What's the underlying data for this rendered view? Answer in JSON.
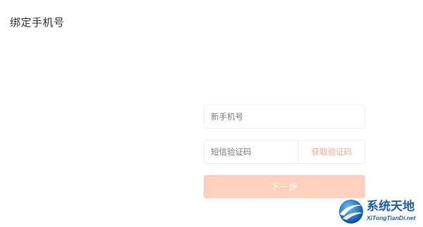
{
  "page": {
    "title": "绑定手机号"
  },
  "form": {
    "phone_placeholder": "新手机号",
    "code_placeholder": "短信验证码",
    "get_code_label": "获取验证码",
    "next_label": "下一步"
  },
  "watermark": {
    "cn_text": "系统天地",
    "en_text": "XiTongTianDi.net",
    "logo_icon": "globe-swoosh-icon"
  },
  "colors": {
    "accent_light": "#fdd1bd",
    "accent_text": "#f5a88a",
    "watermark_blue": "#1a5fb4"
  }
}
